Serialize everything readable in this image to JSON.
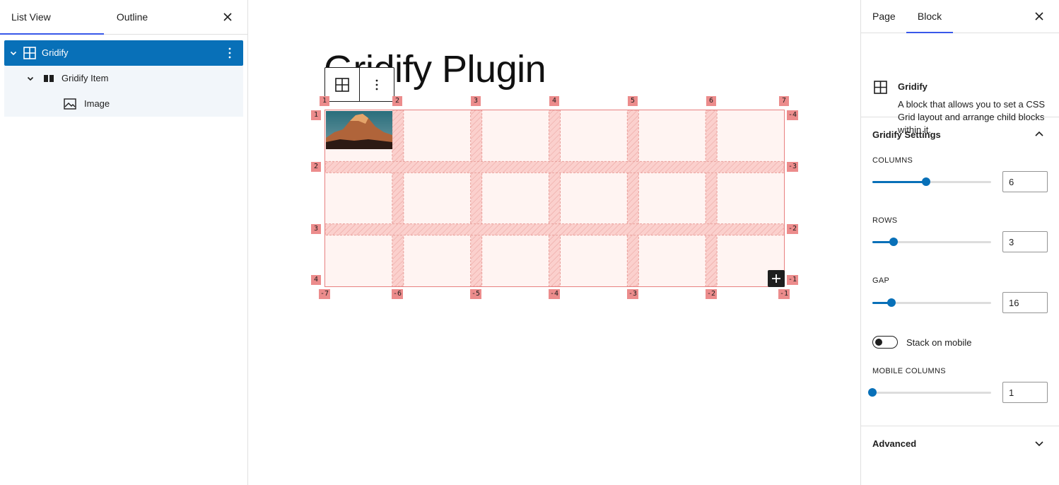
{
  "left_panel": {
    "tabs": [
      "List View",
      "Outline"
    ],
    "close_icon": "close-icon",
    "tree": [
      {
        "label": "Gridify",
        "icon": "grid-icon",
        "level": 0,
        "selected": true
      },
      {
        "label": "Gridify Item",
        "icon": "columns-icon",
        "level": 1
      },
      {
        "label": "Image",
        "icon": "image-icon",
        "level": 2
      }
    ]
  },
  "canvas": {
    "title": "Gridify Plugin",
    "toolbar": {
      "block_icon": "grid-icon",
      "options_icon": "kebab-icon"
    },
    "grid": {
      "columns": 6,
      "rows": 3,
      "top_labels": [
        "1",
        "2",
        "3",
        "4",
        "5",
        "6",
        "7"
      ],
      "bottom_labels": [
        "-7",
        "-6",
        "-5",
        "-4",
        "-3",
        "-2",
        "-1"
      ],
      "left_labels": [
        "1",
        "2",
        "3",
        "4"
      ],
      "right_labels": [
        "-4",
        "-3",
        "-2",
        "-1"
      ],
      "add_icon": "plus-icon"
    }
  },
  "right_panel": {
    "tabs": [
      "Page",
      "Block"
    ],
    "close_icon": "close-icon",
    "block": {
      "name": "Gridify",
      "description": "A block that allows you to set a CSS Grid layout and arrange child blocks within it."
    },
    "settings": {
      "title": "Gridify Settings",
      "columns": {
        "label": "Columns",
        "value": "6",
        "fraction": 0.45
      },
      "rows": {
        "label": "Rows",
        "value": "3",
        "fraction": 0.18
      },
      "gap": {
        "label": "Gap",
        "value": "16",
        "fraction": 0.16
      },
      "stack": {
        "label": "Stack on mobile",
        "checked": false
      },
      "mobile_columns": {
        "label": "Mobile Columns",
        "value": "1",
        "fraction": 0.0
      }
    },
    "advanced": "Advanced"
  },
  "colors": {
    "accent": "#0870b8",
    "tab_indicator": "#3858e9",
    "grid_line": "#ec8c8c",
    "grid_bg": "#fff4f2"
  }
}
